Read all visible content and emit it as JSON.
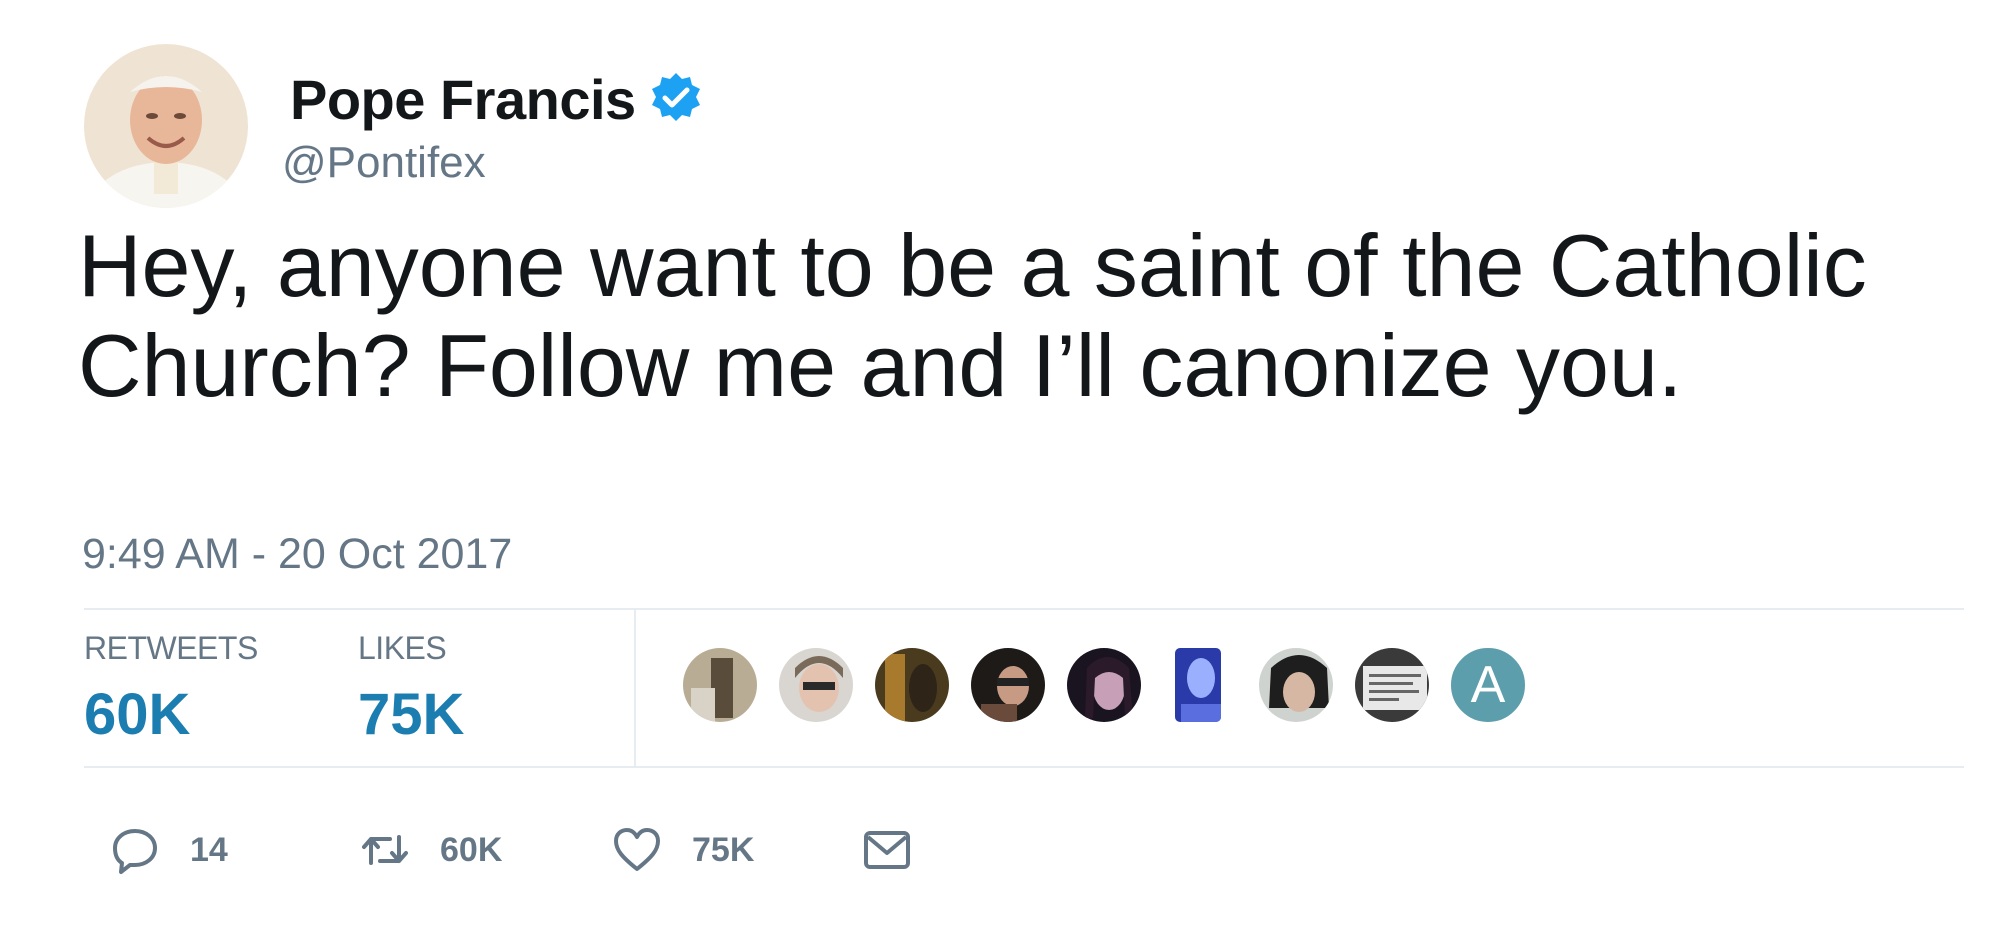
{
  "user": {
    "display_name": "Pope Francis",
    "handle": "@Pontifex",
    "verified": true
  },
  "tweet": {
    "text_line1": "Hey, anyone want to be a saint of the Catholic",
    "text_line2": "Church? Follow me and I’ll canonize you.",
    "timestamp": "9:49 AM - 20 Oct 2017"
  },
  "stats": {
    "retweets_label": "RETWEETS",
    "retweets_value": "60K",
    "likes_label": "LIKES",
    "likes_value": "75K"
  },
  "likers": [
    {
      "icon": "liker-avatar"
    },
    {
      "icon": "liker-avatar"
    },
    {
      "icon": "liker-avatar"
    },
    {
      "icon": "liker-avatar"
    },
    {
      "icon": "liker-avatar"
    },
    {
      "icon": "liker-avatar"
    },
    {
      "icon": "liker-avatar"
    },
    {
      "icon": "liker-avatar"
    },
    {
      "letter": "A"
    }
  ],
  "actions": {
    "reply_count": "14",
    "retweet_count": "60K",
    "like_count": "75K"
  },
  "colors": {
    "verified_blue": "#1da1f2",
    "stat_blue": "#1b7db0",
    "muted_gray": "#657786",
    "divider": "#e6ecf0"
  }
}
